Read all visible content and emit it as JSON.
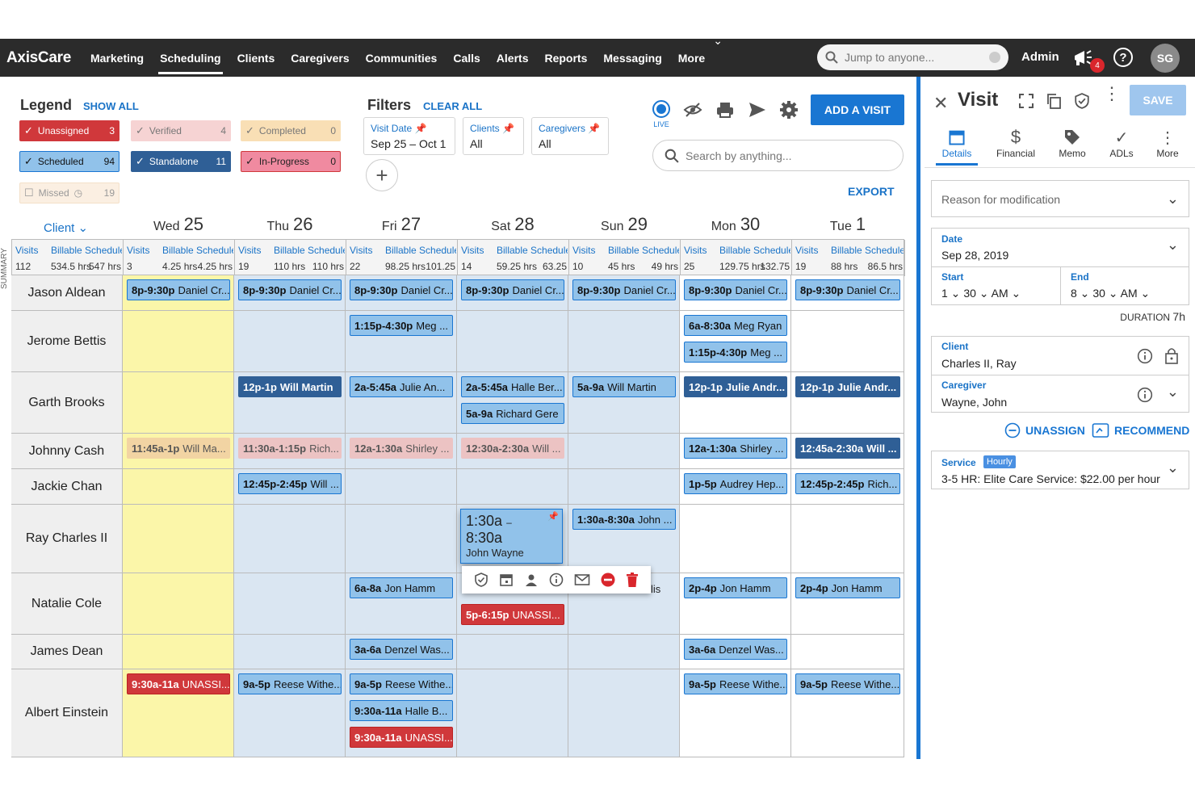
{
  "app": {
    "logo": "AxisCare",
    "nav": [
      "Marketing",
      "Scheduling",
      "Clients",
      "Caregivers",
      "Communities",
      "Calls",
      "Alerts",
      "Reports",
      "Messaging",
      "More"
    ],
    "search_placeholder": "Jump to anyone...",
    "user": "Admin",
    "notif_count": "4",
    "avatar": "SG"
  },
  "legend": {
    "title": "Legend",
    "show_all": "SHOW ALL",
    "items": [
      {
        "label": "Unassigned",
        "count": "3",
        "color": "#d0383b"
      },
      {
        "label": "Verified",
        "count": "4",
        "color": "#ecc3c3"
      },
      {
        "label": "Completed",
        "count": "0",
        "color": "#f2d4a3"
      },
      {
        "label": "Scheduled",
        "count": "94",
        "color": "#91c2ea"
      },
      {
        "label": "Standalone",
        "count": "11",
        "color": "#2f5f96"
      },
      {
        "label": "In-Progress",
        "count": "0",
        "color": "#f08aa0"
      },
      {
        "label": "Missed",
        "count": "19",
        "color": "#f3e0c9"
      }
    ]
  },
  "filters": {
    "title": "Filters",
    "clear": "CLEAR ALL",
    "items": [
      {
        "label": "Visit Date",
        "value": "Sep 25 – Oct 1"
      },
      {
        "label": "Clients",
        "value": "All"
      },
      {
        "label": "Caregivers",
        "value": "All"
      }
    ]
  },
  "toolbar": {
    "live": "LIVE",
    "add_visit": "ADD A VISIT",
    "search_placeholder": "Search by anything...",
    "export": "EXPORT"
  },
  "grid": {
    "client_col": "Client",
    "summary_label": "SUMMARY",
    "days": [
      {
        "dow": "Wed",
        "num": "25"
      },
      {
        "dow": "Thu",
        "num": "26"
      },
      {
        "dow": "Fri",
        "num": "27"
      },
      {
        "dow": "Sat",
        "num": "28"
      },
      {
        "dow": "Sun",
        "num": "29"
      },
      {
        "dow": "Mon",
        "num": "30"
      },
      {
        "dow": "Tue",
        "num": "1"
      }
    ],
    "summary": [
      {
        "visits": "112",
        "billable": "534.5 hrs",
        "sched": "547 hrs"
      },
      {
        "visits": "3",
        "billable": "4.25 hrs",
        "sched": "4.25 hrs"
      },
      {
        "visits": "19",
        "billable": "110 hrs",
        "sched": "110 hrs"
      },
      {
        "visits": "22",
        "billable": "98.25 hrs",
        "sched": "101.25"
      },
      {
        "visits": "14",
        "billable": "59.25 hrs",
        "sched": "63.25"
      },
      {
        "visits": "10",
        "billable": "45 hrs",
        "sched": "49 hrs"
      },
      {
        "visits": "25",
        "billable": "129.75 hrs",
        "sched": "132.75"
      },
      {
        "visits": "19",
        "billable": "88 hrs",
        "sched": "86.5 hrs"
      }
    ],
    "sum_labels": {
      "visits": "Visits",
      "billable": "Billable Schedule"
    },
    "clients": [
      "Jason Aldean",
      "Jerome Bettis",
      "Garth Brooks",
      "Johnny Cash",
      "Jackie Chan",
      "Ray Charles II",
      "Natalie Cole",
      "James Dean",
      "Albert Einstein"
    ],
    "events": [
      {
        "row": 0,
        "day": 0,
        "slot": 0,
        "time": "8p-9:30p",
        "who": "Daniel Cr...",
        "kind": "sched"
      },
      {
        "row": 0,
        "day": 1,
        "slot": 0,
        "time": "8p-9:30p",
        "who": "Daniel Cr...",
        "kind": "sched"
      },
      {
        "row": 0,
        "day": 2,
        "slot": 0,
        "time": "8p-9:30p",
        "who": "Daniel Cr...",
        "kind": "sched"
      },
      {
        "row": 0,
        "day": 3,
        "slot": 0,
        "time": "8p-9:30p",
        "who": "Daniel Cr...",
        "kind": "sched"
      },
      {
        "row": 0,
        "day": 4,
        "slot": 0,
        "time": "8p-9:30p",
        "who": "Daniel Cr...",
        "kind": "sched"
      },
      {
        "row": 0,
        "day": 5,
        "slot": 0,
        "time": "8p-9:30p",
        "who": "Daniel Cr...",
        "kind": "sched"
      },
      {
        "row": 0,
        "day": 6,
        "slot": 0,
        "time": "8p-9:30p",
        "who": "Daniel Cr...",
        "kind": "sched"
      },
      {
        "row": 1,
        "day": 2,
        "slot": 0,
        "time": "1:15p-4:30p",
        "who": "Meg ...",
        "kind": "sched"
      },
      {
        "row": 1,
        "day": 5,
        "slot": 0,
        "time": "6a-8:30a",
        "who": "Meg Ryan",
        "kind": "sched"
      },
      {
        "row": 1,
        "day": 5,
        "slot": 1,
        "time": "1:15p-4:30p",
        "who": "Meg ...",
        "kind": "sched"
      },
      {
        "row": 2,
        "day": 1,
        "slot": 0,
        "time": "12p-1p",
        "who": "Will Martin",
        "kind": "stand"
      },
      {
        "row": 2,
        "day": 2,
        "slot": 0,
        "time": "2a-5:45a",
        "who": "Julie An...",
        "kind": "sched"
      },
      {
        "row": 2,
        "day": 3,
        "slot": 0,
        "time": "2a-5:45a",
        "who": "Halle Ber...",
        "kind": "sched"
      },
      {
        "row": 2,
        "day": 3,
        "slot": 1,
        "time": "5a-9a",
        "who": "Richard Gere",
        "kind": "sched"
      },
      {
        "row": 2,
        "day": 4,
        "slot": 0,
        "time": "5a-9a",
        "who": "Will Martin",
        "kind": "sched"
      },
      {
        "row": 2,
        "day": 5,
        "slot": 0,
        "time": "12p-1p",
        "who": "Julie Andr...",
        "kind": "stand"
      },
      {
        "row": 2,
        "day": 6,
        "slot": 0,
        "time": "12p-1p",
        "who": "Julie Andr...",
        "kind": "stand"
      },
      {
        "row": 3,
        "day": 0,
        "slot": 0,
        "time": "11:45a-1p",
        "who": "Will Ma...",
        "kind": "completed"
      },
      {
        "row": 3,
        "day": 1,
        "slot": 0,
        "time": "11:30a-1:15p",
        "who": "Rich...",
        "kind": "verified"
      },
      {
        "row": 3,
        "day": 2,
        "slot": 0,
        "time": "12a-1:30a",
        "who": "Shirley ...",
        "kind": "verified"
      },
      {
        "row": 3,
        "day": 3,
        "slot": 0,
        "time": "12:30a-2:30a",
        "who": "Will ...",
        "kind": "verified"
      },
      {
        "row": 3,
        "day": 5,
        "slot": 0,
        "time": "12a-1:30a",
        "who": "Shirley ...",
        "kind": "sched"
      },
      {
        "row": 3,
        "day": 6,
        "slot": 0,
        "time": "12:45a-2:30a",
        "who": "Will ...",
        "kind": "stand"
      },
      {
        "row": 4,
        "day": 1,
        "slot": 0,
        "time": "12:45p-2:45p",
        "who": "Will ...",
        "kind": "sched"
      },
      {
        "row": 4,
        "day": 5,
        "slot": 0,
        "time": "1p-5p",
        "who": "Audrey Hep...",
        "kind": "sched"
      },
      {
        "row": 4,
        "day": 6,
        "slot": 0,
        "time": "12:45p-2:45p",
        "who": "Rich...",
        "kind": "sched"
      },
      {
        "row": 5,
        "day": 4,
        "slot": 0,
        "time": "1:30a-8:30a",
        "who": "John ...",
        "kind": "sched"
      },
      {
        "row": 6,
        "day": 2,
        "slot": 0,
        "time": "6a-8a",
        "who": "Jon Hamm",
        "kind": "sched"
      },
      {
        "row": 6,
        "day": 3,
        "slot": 1,
        "time": "5p-6:15p",
        "who": "UNASSI...",
        "kind": "unassigned"
      },
      {
        "row": 6,
        "day": 5,
        "slot": 0,
        "time": "2p-4p",
        "who": "Jon Hamm",
        "kind": "sched"
      },
      {
        "row": 6,
        "day": 6,
        "slot": 0,
        "time": "2p-4p",
        "who": "Jon Hamm",
        "kind": "sched"
      },
      {
        "row": 7,
        "day": 2,
        "slot": 0,
        "time": "3a-6a",
        "who": "Denzel Was...",
        "kind": "sched"
      },
      {
        "row": 7,
        "day": 5,
        "slot": 0,
        "time": "3a-6a",
        "who": "Denzel Was...",
        "kind": "sched"
      },
      {
        "row": 8,
        "day": 0,
        "slot": 0,
        "time": "9:30a-11a",
        "who": "UNASSI...",
        "kind": "unassigned"
      },
      {
        "row": 8,
        "day": 1,
        "slot": 0,
        "time": "9a-5p",
        "who": "Reese Withe...",
        "kind": "sched"
      },
      {
        "row": 8,
        "day": 2,
        "slot": 0,
        "time": "9a-5p",
        "who": "Reese Withe...",
        "kind": "sched"
      },
      {
        "row": 8,
        "day": 2,
        "slot": 1,
        "time": "9:30a-11a",
        "who": "Halle B...",
        "kind": "sched"
      },
      {
        "row": 8,
        "day": 2,
        "slot": 2,
        "time": "9:30a-11a",
        "who": "UNASSI...",
        "kind": "unassigned"
      },
      {
        "row": 8,
        "day": 5,
        "slot": 0,
        "time": "9a-5p",
        "who": "Reese Withe...",
        "kind": "sched"
      },
      {
        "row": 8,
        "day": 6,
        "slot": 0,
        "time": "9a-5p",
        "who": "Reese Withe...",
        "kind": "sched"
      }
    ]
  },
  "popup": {
    "start": "1:30a",
    "end": "8:30a",
    "caregiver": "John Wayne",
    "behind_fragment": "lis"
  },
  "panel": {
    "title": "Visit",
    "save": "SAVE",
    "tabs": [
      "Details",
      "Financial",
      "Memo",
      "ADLs",
      "More"
    ],
    "reason_placeholder": "Reason for modification",
    "date_label": "Date",
    "date_value": "Sep 28, 2019",
    "start_label": "Start",
    "start_h": "1",
    "start_m": "30",
    "start_ampm": "AM",
    "end_label": "End",
    "end_h": "8",
    "end_m": "30",
    "end_ampm": "AM",
    "duration_label": "DURATION",
    "duration_value": "7h",
    "client_label": "Client",
    "client_value": "Charles II, Ray",
    "caregiver_label": "Caregiver",
    "caregiver_value": "Wayne, John",
    "unassign": "UNASSIGN",
    "recommend": "RECOMMEND",
    "service_label": "Service",
    "service_badge": "Hourly",
    "service_value": "3-5 HR: Elite Care Service: $22.00 per hour"
  }
}
